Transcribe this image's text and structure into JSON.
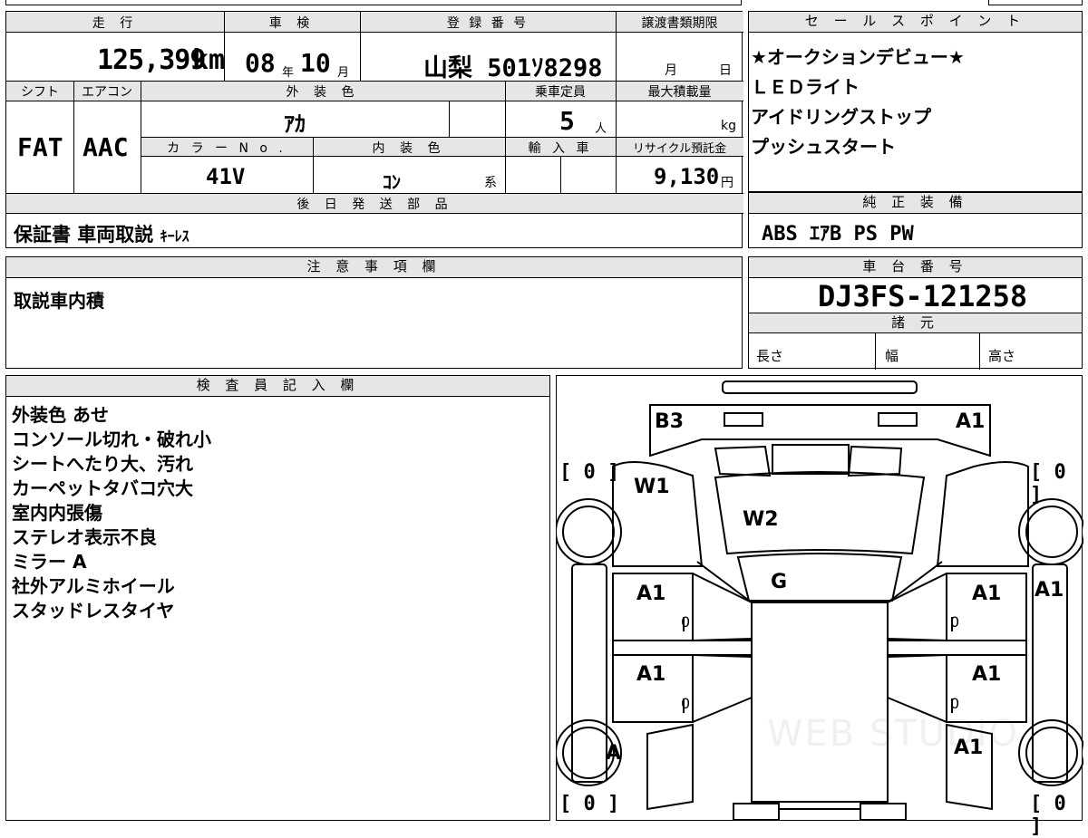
{
  "top": {
    "mileage_label": "走 行",
    "mileage_value": "125,399",
    "mileage_unit": "km",
    "shaken_label": "車 検",
    "shaken_year": "08",
    "shaken_year_unit": "年",
    "shaken_month": "10",
    "shaken_month_unit": "月",
    "reg_label": "登 録 番 号",
    "reg_value": "山梨 501ｿ8298",
    "transfer_label": "譲渡書類期限",
    "transfer_month_unit": "月",
    "transfer_day_unit": "日",
    "shift_label": "シフト",
    "shift_value": "FAT",
    "ac_label": "エアコン",
    "ac_value": "AAC",
    "exterior_label": "外 装 色",
    "exterior_value": "ｱｶ",
    "capacity_label": "乗車定員",
    "capacity_value": "5",
    "capacity_unit": "人",
    "maxload_label": "最大積載量",
    "maxload_unit": "kg",
    "colorno_label": "カ ラ ー N o .",
    "colorno_value": "41V",
    "interior_label": "内 装 色",
    "interior_value": "ｺﾝ",
    "interior_suffix": "系",
    "import_label": "輸 入 車",
    "recycle_label": "リサイクル預託金",
    "recycle_value": "9,130",
    "recycle_unit": "円"
  },
  "later": {
    "label": "後 日 発 送 部 品",
    "value_main": "保証書 車両取説",
    "value_small": "ｷｰﾚｽ"
  },
  "notes": {
    "label": "注 意 事 項 欄",
    "value": "取説車内積"
  },
  "sales": {
    "label": "セ ー ル ス ポ イ ン ト",
    "items": [
      "★オークションデビュー★",
      "ＬＥＤライト",
      "アイドリングストップ",
      "プッシュスタート"
    ]
  },
  "equip": {
    "label": "純 正 装 備",
    "value": "ABS ｴｱB PS PW"
  },
  "chassis": {
    "label": "車 台 番 号",
    "value": "DJ3FS-121258",
    "specs_label": "諸 元",
    "length_label": "長さ",
    "width_label": "幅",
    "height_label": "高さ"
  },
  "inspector": {
    "label": "検 査 員 記 入 欄",
    "lines": [
      "外装色 あせ",
      "コンソール切れ・破れ小",
      "シートへたり大、汚れ",
      "カーペットタバコ穴大",
      "室内内張傷",
      "ステレオ表示不良",
      "ミラー A",
      "社外アルミホイール",
      "スタッドレスタイヤ"
    ]
  },
  "diagram": {
    "b3": "B3",
    "a1_top_right": "A1",
    "w1": "W1",
    "w2": "W2",
    "g": "G",
    "a1_left_front_door": "A1",
    "a1_right_front_door": "A1",
    "a1_right_fender": "A1",
    "a1_left_rear_door": "A1",
    "a1_right_rear_door": "A1",
    "a_left_rear_wheel": "A",
    "a1_right_rear_quarter": "A1",
    "tire_fl": "[ 0 ]",
    "tire_fr": "[ 0 ]",
    "tire_rl": "[ 0 ]",
    "tire_rr": "[ 0 ]",
    "door_zero_fl": "0",
    "door_zero_fr": "0",
    "door_zero_rl": "0",
    "door_zero_rr": "0",
    "watermark": "WEB STUDIO"
  }
}
